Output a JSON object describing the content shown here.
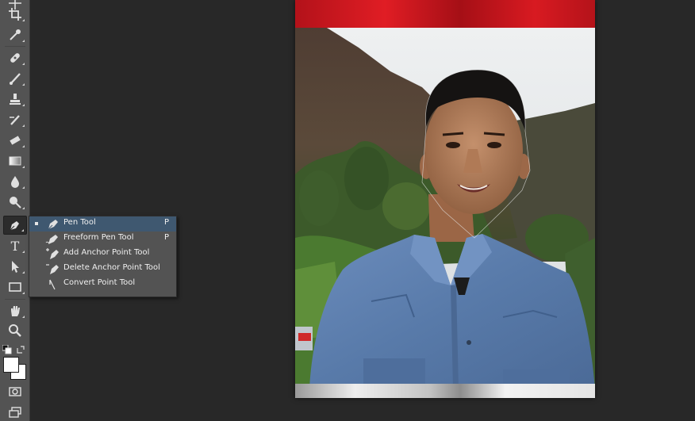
{
  "toolbar": {
    "tools": [
      "move-icon",
      "crop-icon",
      "eyedropper-icon",
      "spot-healing-icon",
      "brush-icon",
      "clone-stamp-icon",
      "history-brush-icon",
      "eraser-icon",
      "gradient-icon",
      "blur-icon",
      "dodge-icon",
      "pen-icon",
      "type-icon",
      "path-selection-icon",
      "rectangle-icon",
      "hand-icon",
      "zoom-icon",
      "swap-colors-icon",
      "color-swatches-icon",
      "quick-mask-icon",
      "screen-mode-icon"
    ],
    "active_tool": "pen-icon",
    "type_glyph": "T"
  },
  "flyout": {
    "items": [
      {
        "label": "Pen Tool",
        "shortcut": "P"
      },
      {
        "label": "Freeform Pen Tool",
        "shortcut": "P"
      },
      {
        "label": "Add Anchor Point Tool",
        "shortcut": ""
      },
      {
        "label": "Delete Anchor Point Tool",
        "shortcut": ""
      },
      {
        "label": "Convert Point Tool",
        "shortcut": ""
      }
    ],
    "selected_index": 0
  },
  "document": {
    "image_name": "portrait-photo",
    "colors": {
      "top_band": "#c8161c",
      "bottom_band": "#d9d9d9",
      "shirt": "#5a7aa8",
      "sky": "#dfe3e6"
    }
  }
}
